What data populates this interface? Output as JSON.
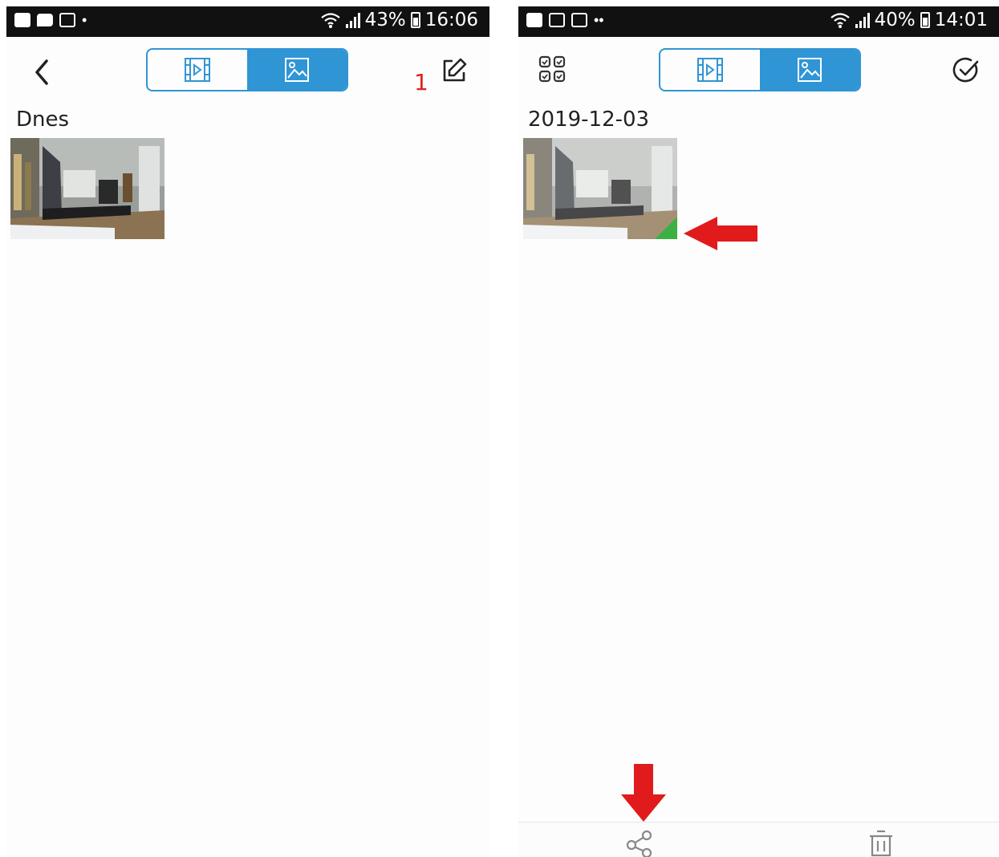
{
  "left_screen": {
    "status": {
      "battery": "43%",
      "time": "16:06"
    },
    "annotation_number": "1",
    "section_label": "Dnes",
    "buttons": {
      "back": "back-icon",
      "edit": "edit-icon",
      "video_tab": "video-icon",
      "photo_tab": "photo-icon"
    }
  },
  "right_screen": {
    "status": {
      "battery": "40%",
      "time": "14:01"
    },
    "section_label": "2019-12-03",
    "buttons": {
      "select_all": "grid-select-icon",
      "check": "check-circle-icon",
      "share": "share-icon",
      "delete": "trash-icon"
    }
  },
  "colors": {
    "accent": "#2f95d5",
    "annotation_red": "#e02020",
    "selected_mark": "#3cb044",
    "status_bar": "#111111"
  }
}
